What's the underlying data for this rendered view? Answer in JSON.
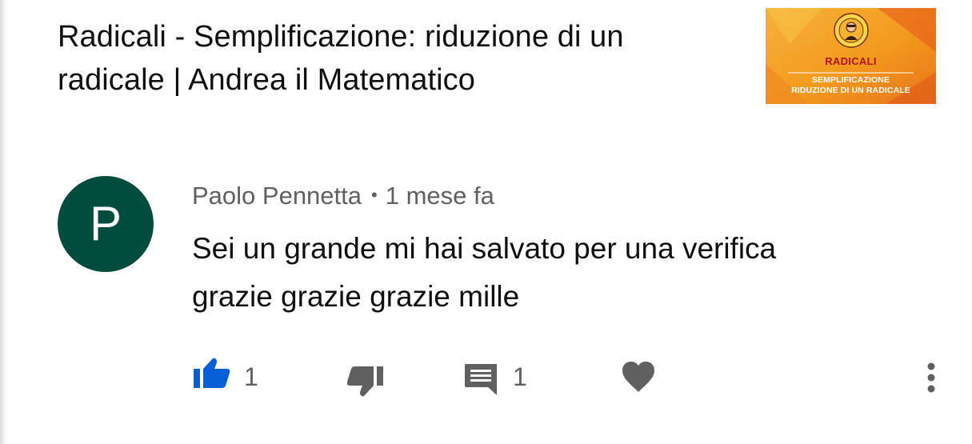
{
  "video": {
    "title": "Radicali - Semplificazione: riduzione di un radicale | Andrea il Matematico",
    "thumbnail": {
      "title": "RADICALI",
      "subtitle_line1": "SEMPLIFICAZIONE",
      "subtitle_line2": "RIDUZIONE DI UN RADICALE",
      "logo_icon": "andrea-il-matematico-logo-icon",
      "colors": {
        "background": "#f29a1d",
        "accent": "#e4561a",
        "title": "#b3121a"
      }
    }
  },
  "comment": {
    "avatar_letter": "P",
    "avatar_color": "#004d40",
    "author": "Paolo Pennetta",
    "separator": "•",
    "timestamp": "1 mese fa",
    "text_line1": "Sei un grande mi hai salvato per una verifica",
    "text_line2": "grazie grazie grazie mille",
    "actions": {
      "like": {
        "icon": "thumbs-up-icon",
        "count": "1",
        "active": true,
        "color": "#065fd4"
      },
      "dislike": {
        "icon": "thumbs-down-icon"
      },
      "reply": {
        "icon": "comment-icon",
        "count": "1"
      },
      "heart": {
        "icon": "heart-icon"
      },
      "menu": {
        "icon": "more-vertical-icon"
      }
    }
  }
}
